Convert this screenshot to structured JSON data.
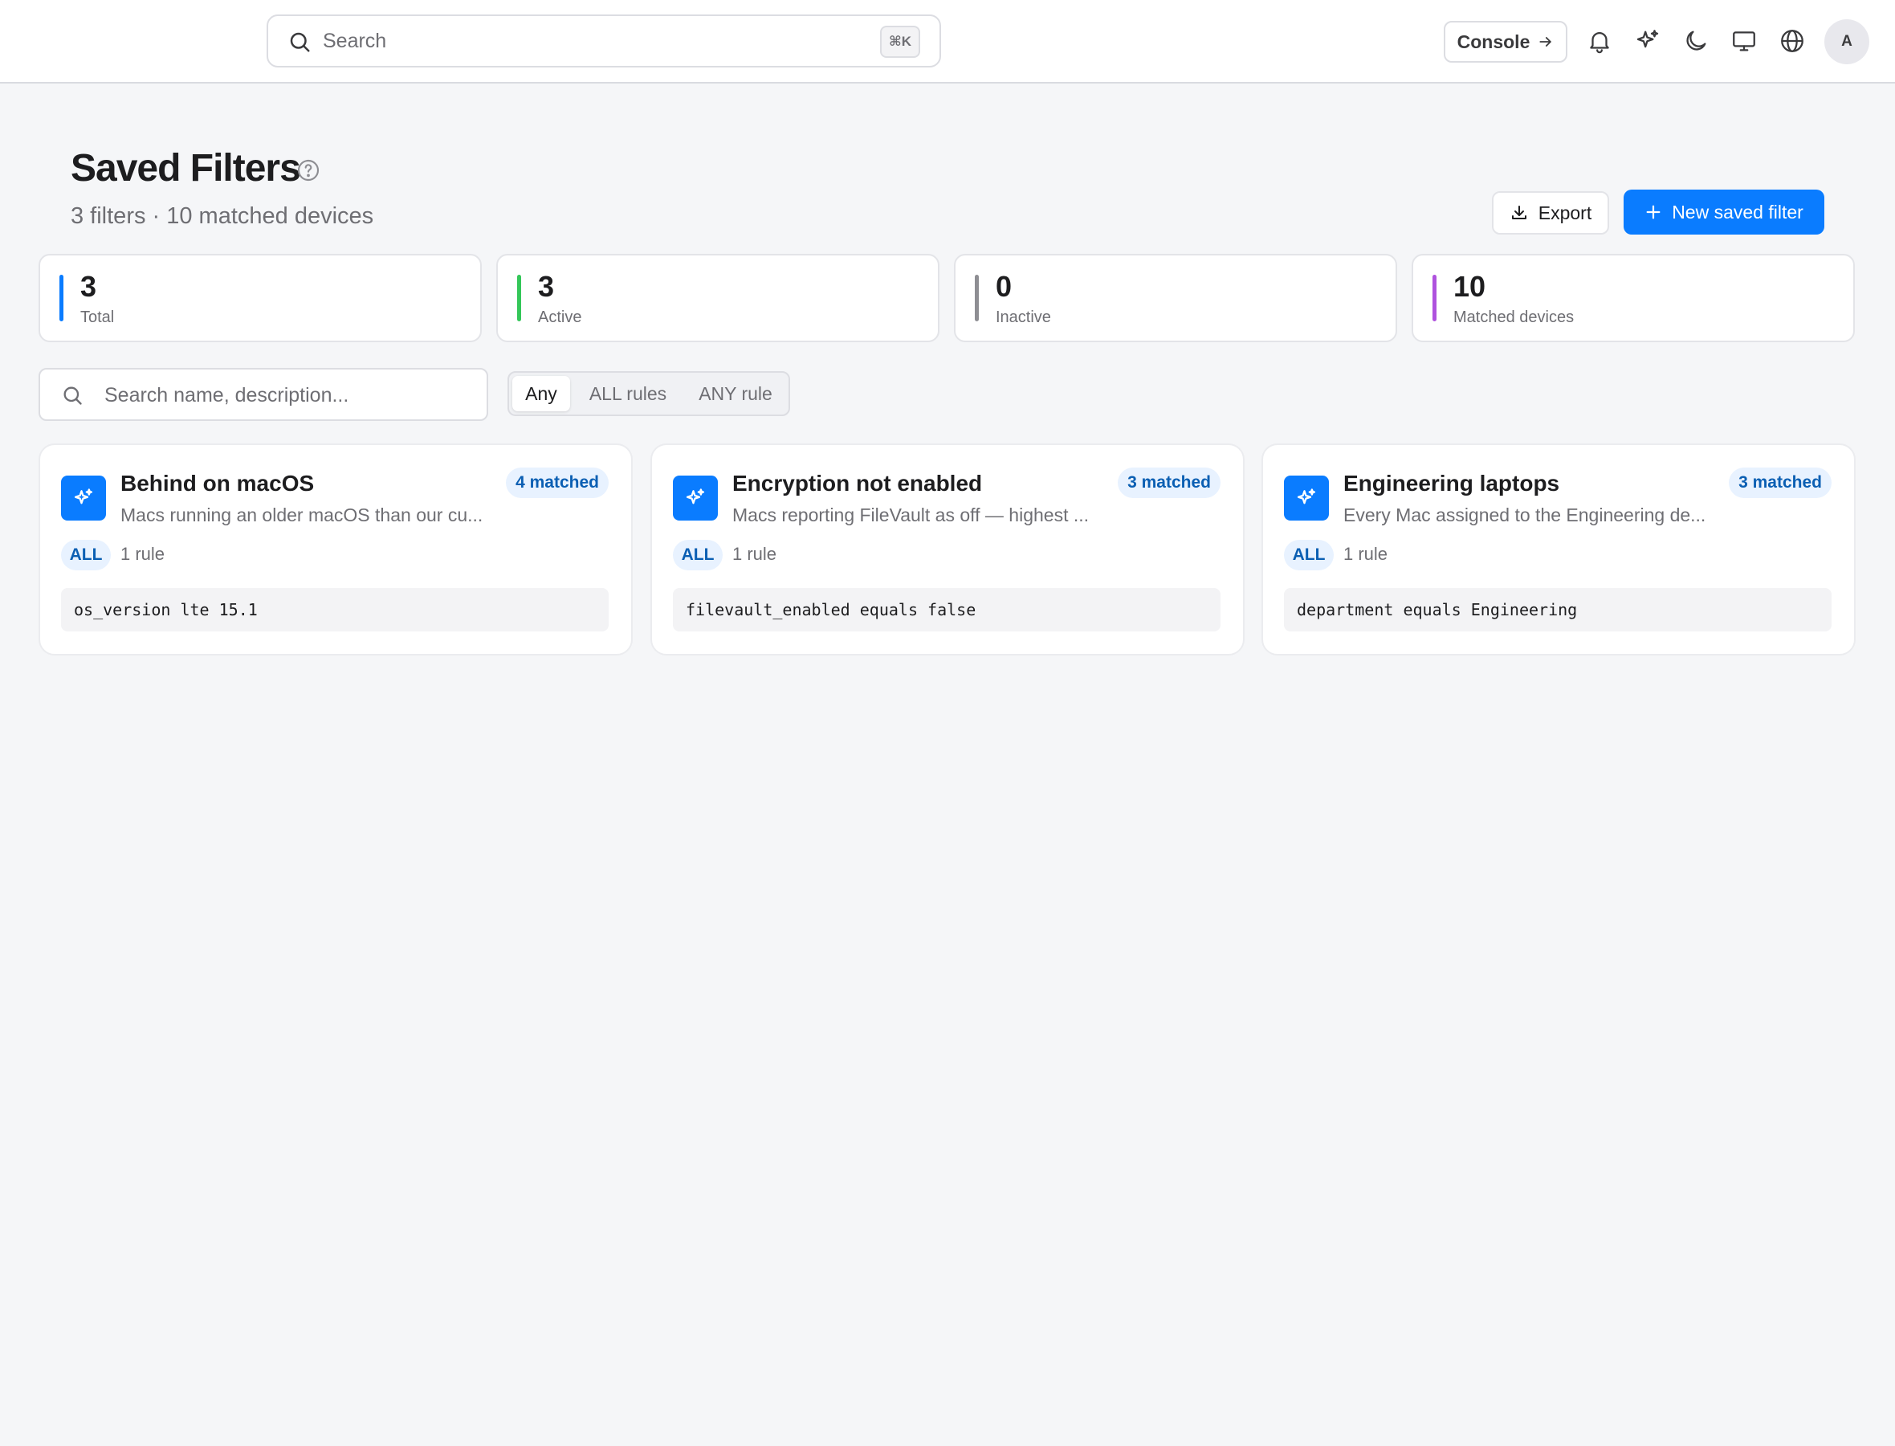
{
  "topbar": {
    "search_placeholder": "Search",
    "search_shortcut": "⌘K",
    "console_label": "Console",
    "icons": [
      "bell-icon",
      "sparkles-icon",
      "moon-icon",
      "monitor-icon",
      "globe-icon"
    ],
    "avatar_initial": "A"
  },
  "header": {
    "title": "Saved Filters",
    "subtitle": "3 filters · 10 matched devices",
    "export_label": "Export",
    "new_filter_label": "New saved filter"
  },
  "stats": [
    {
      "value": "3",
      "label": "Total",
      "color": "#0a7cff"
    },
    {
      "value": "3",
      "label": "Active",
      "color": "#34c759"
    },
    {
      "value": "0",
      "label": "Inactive",
      "color": "#8e8e93"
    },
    {
      "value": "10",
      "label": "Matched devices",
      "color": "#af52de"
    }
  ],
  "filter_bar": {
    "search_placeholder": "Search name, description...",
    "segments": [
      "Any",
      "ALL rules",
      "ANY rule"
    ],
    "active_segment": "Any"
  },
  "filters": [
    {
      "title": "Behind on macOS",
      "description": "Macs running an older macOS than our cu...",
      "matched": "4 matched",
      "mode": "ALL",
      "rule_count": "1 rule",
      "rule": "os_version lte 15.1"
    },
    {
      "title": "Encryption not enabled",
      "description": "Macs reporting FileVault as off — highest ...",
      "matched": "3 matched",
      "mode": "ALL",
      "rule_count": "1 rule",
      "rule": "filevault_enabled equals false"
    },
    {
      "title": "Engineering laptops",
      "description": "Every Mac assigned to the Engineering de...",
      "matched": "3 matched",
      "mode": "ALL",
      "rule_count": "1 rule",
      "rule": "department equals Engineering"
    }
  ],
  "colors": {
    "accent": "#0a7cff",
    "badge_bg": "#e8f2ff",
    "badge_text": "#0b5fb3"
  }
}
